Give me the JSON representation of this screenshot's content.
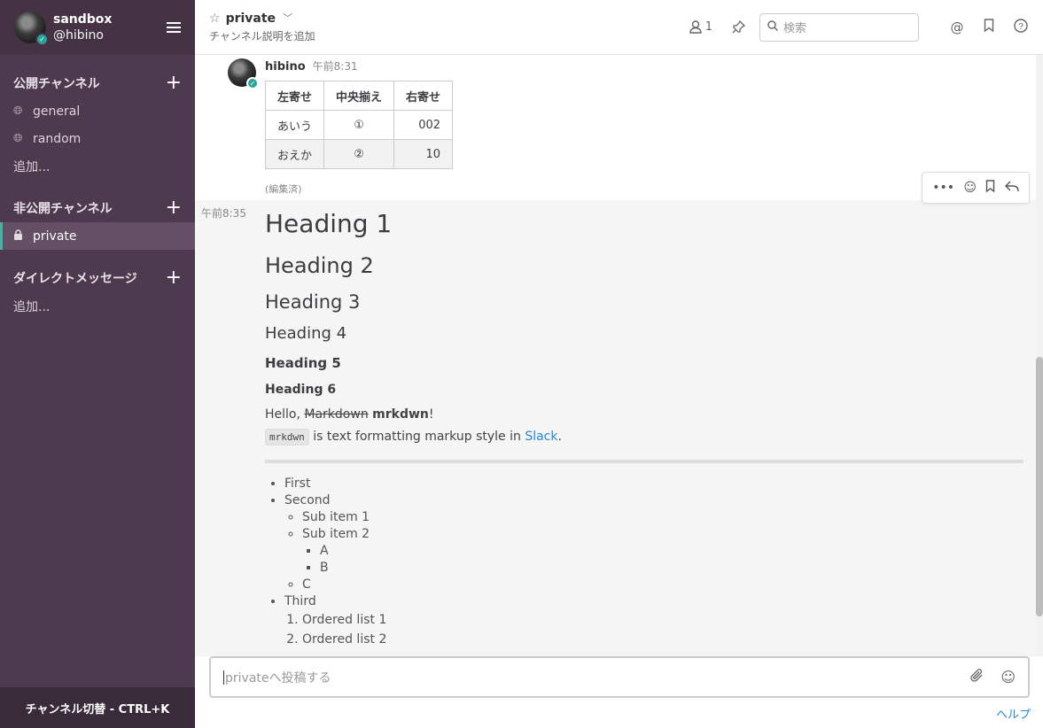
{
  "sidebar": {
    "team_name": "sandbox",
    "user_handle": "@hibino",
    "sections": {
      "public": {
        "title": "公開チャンネル",
        "items": [
          "general",
          "random"
        ],
        "add": "追加..."
      },
      "private": {
        "title": "非公開チャンネル",
        "items": [
          "private"
        ]
      },
      "dm": {
        "title": "ダイレクトメッセージ",
        "add": "追加..."
      }
    },
    "footer": "チャンネル切替 - CTRL+K"
  },
  "header": {
    "channel_name": "private",
    "channel_desc": "チャンネル説明を追加",
    "member_count": "1",
    "search_placeholder": "検索"
  },
  "messages": {
    "m1": {
      "user": "hibino",
      "time": "午前8:31",
      "table": {
        "headers": [
          "左寄せ",
          "中央揃え",
          "右寄せ"
        ],
        "rows": [
          [
            "あいう",
            "①",
            "002"
          ],
          [
            "おえか",
            "②",
            "10"
          ]
        ]
      },
      "edited": "(編集済)"
    },
    "m2": {
      "time": "午前8:35",
      "headings": [
        "Heading 1",
        "Heading 2",
        "Heading 3",
        "Heading 4",
        "Heading 5",
        "Heading 6"
      ],
      "hello_prefix": "Hello, ",
      "strike": "Markdown",
      "bold": "mrkdwn",
      "hello_suffix": "!",
      "code": "mrkdwn",
      "desc_text": " is text formatting markup style in ",
      "link": "Slack",
      "period": ".",
      "list": {
        "first": "First",
        "second": "Second",
        "sub1": "Sub item 1",
        "sub2": "Sub item 2",
        "a": "A",
        "b": "B",
        "c": "C",
        "third": "Third",
        "ordered": [
          "Ordered list 1",
          "Ordered list 2"
        ]
      }
    }
  },
  "composer": {
    "placeholder": "privateへ投稿する"
  },
  "help_link": "ヘルプ"
}
